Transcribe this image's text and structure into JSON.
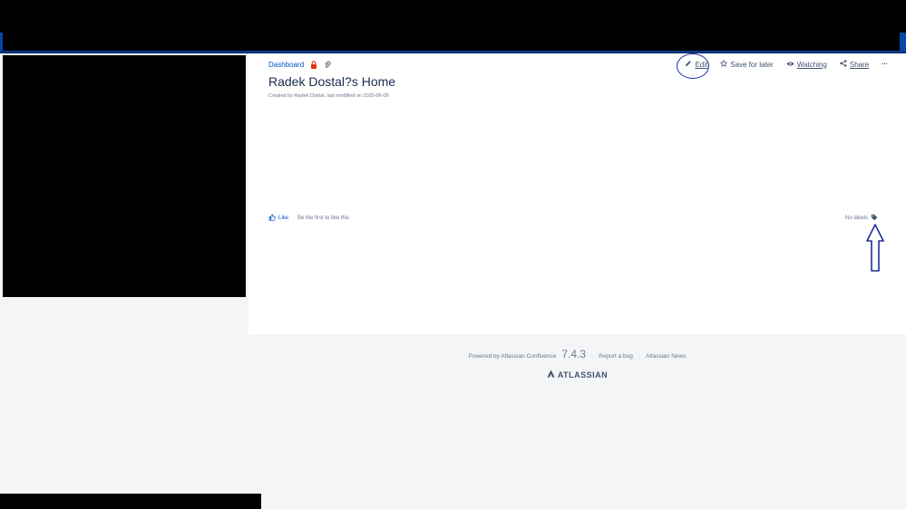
{
  "breadcrumb": {
    "dashboard_label": "Dashboard"
  },
  "page": {
    "title": "Radek Dostal?s Home",
    "byline": "Created by Radek Dostal, last modified on 2020-06-09"
  },
  "actions": {
    "edit_label": "Edit",
    "save_label": "Save for later",
    "watching_label": "Watching",
    "share_label": "Share",
    "more_label": "•••"
  },
  "likes": {
    "like_label": "Like",
    "hint": "Be the first to like this"
  },
  "labels": {
    "text": "No labels"
  },
  "footer": {
    "powered_by": "Powered by Atlassian Confluence",
    "version": "7.4.3",
    "report_bug": "Report a bug",
    "news": "Atlassian News",
    "brand": "ATLASSIAN"
  },
  "colors": {
    "link": "#0052cc",
    "annotation": "#1a2f9a",
    "restriction": "#de350b"
  },
  "icons": [
    "lock-icon",
    "attachment-icon",
    "pencil-icon",
    "star-icon",
    "eye-icon",
    "share-icon",
    "more-icon",
    "thumbs-up-icon",
    "tag-icon",
    "atlassian-logo-icon"
  ]
}
